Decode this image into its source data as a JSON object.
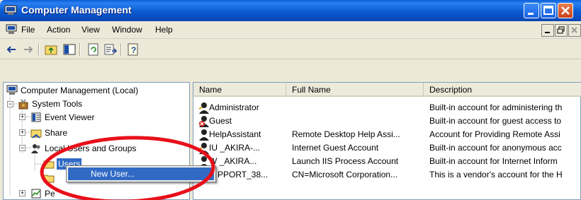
{
  "window": {
    "title": "Computer Management",
    "icon": "computer-management-icon"
  },
  "menu": {
    "items": [
      "File",
      "Action",
      "View",
      "Window",
      "Help"
    ]
  },
  "toolbar": {
    "icons": [
      "back-arrow-icon",
      "forward-arrow-icon",
      "up-folder-icon",
      "show-hide-tree-icon",
      "refresh-icon",
      "export-list-icon",
      "help-icon"
    ]
  },
  "tree": {
    "items": [
      {
        "label": "Computer Management (Local)",
        "icon": "computer-icon"
      },
      {
        "label": "System Tools",
        "icon": "system-tools-icon"
      },
      {
        "label": "Event Viewer",
        "icon": "event-viewer-icon"
      },
      {
        "label": "Shared Folders",
        "icon": "shared-folders-icon",
        "visible_label": "Share"
      },
      {
        "label": "Local Users and Groups",
        "icon": "users-groups-icon",
        "visible_label": "Local Users and Groups"
      },
      {
        "label": "Users",
        "icon": "folder-icon",
        "selected": true
      },
      {
        "label": "Pe",
        "icon": "performance-icon"
      }
    ]
  },
  "list": {
    "columns": [
      "Name",
      "Full Name",
      "Description"
    ],
    "rows": [
      {
        "name": "Administrator",
        "full_name": "",
        "description": "Built-in account for administering th",
        "icon": "user-icon"
      },
      {
        "name": "Guest",
        "full_name": "",
        "description": "Built-in account for guest access to",
        "icon": "disabled-user-icon"
      },
      {
        "name": "HelpAssistant",
        "full_name": "Remote Desktop Help Assi...",
        "description": "Account for Providing Remote Assi",
        "icon": "disabled-user-icon"
      },
      {
        "name": "IU _AKIRA-...",
        "full_name": "Internet Guest Account",
        "description": "Built-in account for anonymous acc",
        "icon": "user-icon"
      },
      {
        "name": "W _AKIRA...",
        "full_name": "Launch IIS Process Account",
        "description": "Built-in account for Internet Inform",
        "icon": "user-icon"
      },
      {
        "name": "PPORT_38...",
        "full_name": "CN=Microsoft Corporation...",
        "description": "This is a vendor's account for the H",
        "icon": "user-icon"
      }
    ]
  },
  "context_menu": {
    "items": [
      "New User..."
    ]
  },
  "colors": {
    "titlebar": "#0a5fd8",
    "selection": "#316ac5",
    "annotation": "#e8101a"
  }
}
